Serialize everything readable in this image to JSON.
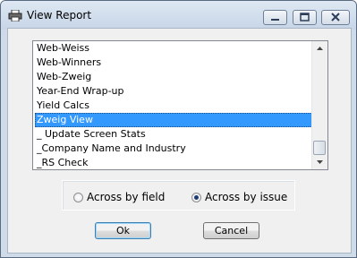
{
  "window": {
    "title": "View Report"
  },
  "list": {
    "items": [
      "Web-Weiss",
      "Web-Winners",
      "Web-Zweig",
      "Year-End Wrap-up",
      "Yield Calcs",
      "Zweig View",
      "_ Update Screen Stats",
      "_Company Name and Industry",
      "_RS Check"
    ],
    "selected": "Zweig View"
  },
  "layout_option": {
    "across_by_field": "Across by field",
    "across_by_issue": "Across by issue",
    "selected": "Across by issue"
  },
  "buttons": {
    "ok": "Ok",
    "cancel": "Cancel"
  },
  "colors": {
    "selection": "#3399ff",
    "titlebar": "#c6d5e7"
  }
}
